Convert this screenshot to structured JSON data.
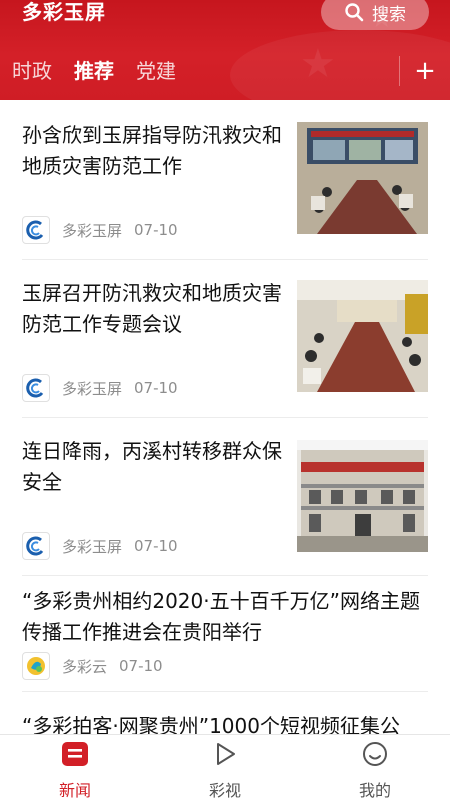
{
  "header": {
    "app_title": "多彩玉屏",
    "search_label": "搜索",
    "tabs": [
      "时政",
      "推荐",
      "党建"
    ],
    "active_tab": "推荐",
    "add_icon": "plus-icon",
    "brand_color": "#d21f27"
  },
  "articles": [
    {
      "title": "孙含欣到玉屏指导防汛救灾和地质灾害防范工作",
      "source": "多彩玉屏",
      "date": "07-10",
      "has_thumbnail": true
    },
    {
      "title": "玉屏召开防汛救灾和地质灾害防范工作专题会议",
      "source": "多彩玉屏",
      "date": "07-10",
      "has_thumbnail": true
    },
    {
      "title": "连日降雨，丙溪村转移群众保安全",
      "source": "多彩玉屏",
      "date": "07-10",
      "has_thumbnail": true
    },
    {
      "title": "“多彩贵州相约2020·五十百千万亿”网络主题传播工作推进会在贵阳举行",
      "source": "多彩云",
      "date": "07-10",
      "has_thumbnail": false
    },
    {
      "title": "“多彩拍客·网聚贵州”1000个短视频征集公"
    }
  ],
  "bottom_nav": [
    {
      "label": "新闻",
      "icon": "news-icon",
      "active": true
    },
    {
      "label": "彩视",
      "icon": "play-icon",
      "active": false
    },
    {
      "label": "我的",
      "icon": "smiley-icon",
      "active": false
    }
  ]
}
